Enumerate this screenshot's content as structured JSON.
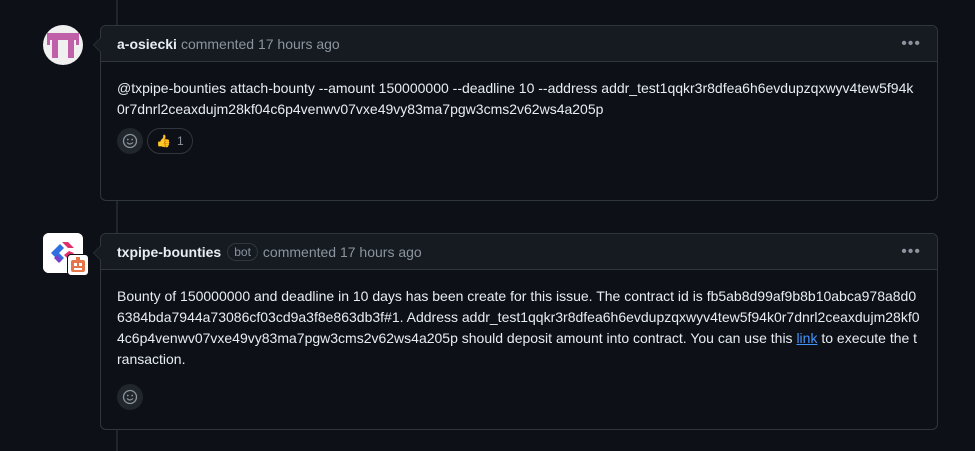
{
  "comments": [
    {
      "author": "a-osiecki",
      "meta": "commented 17 hours ago",
      "body": "@txpipe-bounties attach-bounty --amount 150000000 --deadline 10 --address addr_test1qqkr3r8dfea6h6evdupzqxwyv4tew5f94k0r7dnrl2ceaxdujm28kf04c6p4venwv07vxe49vy83ma7pgw3cms2v62ws4a205p",
      "reactions": [
        {
          "emoji": "👍",
          "count": "1"
        }
      ]
    },
    {
      "author": "txpipe-bounties",
      "badge": "bot",
      "meta": "commented 17 hours ago",
      "body_before_link": "Bounty of 150000000 and deadline in 10 days has been create for this issue. The contract id is fb5ab8d99af9b8b10abca978a8d06384bda7944a73086cf03cd9a3f8e863db3f#1. Address addr_test1qqkr3r8dfea6h6evdupzqxwyv4tew5f94k0r7dnrl2ceaxdujm28kf04c6p4venwv07vxe49vy83ma7pgw3cms2v62ws4a205p should deposit amount into contract. You can use this ",
      "link_text": "link",
      "body_after_link": " to execute the transaction."
    }
  ],
  "icons": {
    "kebab": "kebab-horizontal-icon",
    "emoji": "smiley-icon"
  },
  "colors": {
    "background": "#0d1117",
    "header": "#161b22",
    "border": "#30363d",
    "link": "#4493f8",
    "muted": "#8b949e"
  }
}
